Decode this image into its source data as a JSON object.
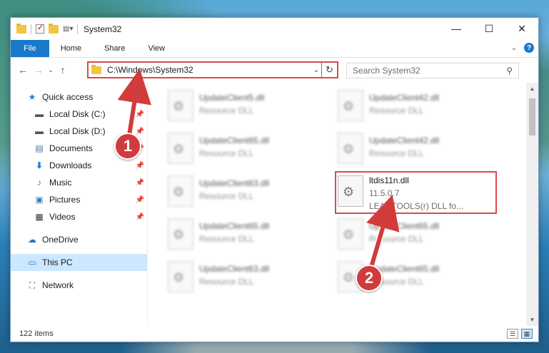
{
  "window": {
    "title": "System32",
    "controls": {
      "minimize": "—",
      "maximize": "☐",
      "close": "✕"
    }
  },
  "ribbon": {
    "tabs": [
      "File",
      "Home",
      "Share",
      "View"
    ],
    "help": "?"
  },
  "address": {
    "path": "C:\\Windows\\System32",
    "search_placeholder": "Search System32"
  },
  "sidebar": {
    "quick_access": "Quick access",
    "items": [
      {
        "label": "Local Disk (C:)",
        "icon": "drive-icon"
      },
      {
        "label": "Local Disk (D:)",
        "icon": "drive-icon"
      },
      {
        "label": "Documents",
        "icon": "documents-icon"
      },
      {
        "label": "Downloads",
        "icon": "downloads-icon"
      },
      {
        "label": "Music",
        "icon": "music-icon"
      },
      {
        "label": "Pictures",
        "icon": "pictures-icon"
      },
      {
        "label": "Videos",
        "icon": "videos-icon"
      }
    ],
    "onedrive": "OneDrive",
    "thispc": "This PC",
    "network": "Network"
  },
  "files": {
    "left": [
      {
        "name": "UpdateClient5.dll",
        "type": "Resource DLL"
      },
      {
        "name": "UpdateClient65.dll",
        "type": "Resource DLL"
      },
      {
        "name": "UpdateClient63.dll",
        "type": "Resource DLL"
      },
      {
        "name": "UpdateClient65.dll",
        "type": "Resource DLL"
      },
      {
        "name": "UpdateClient63.dll",
        "type": "Resource DLL"
      }
    ],
    "right": [
      {
        "name": "UpdateClient42.dll",
        "type": "Resource DLL"
      },
      {
        "name": "UpdateClient42.dll",
        "type": "Resource DLL"
      },
      {
        "name": "UpdateClient65.dll",
        "type": "Resource DLL"
      },
      {
        "name": "UpdateClient65.dll",
        "type": "Resource DLL"
      }
    ],
    "highlighted": {
      "name": "ltdis11n.dll",
      "version": "11.5.0.7",
      "description": "LEADTOOLS(r) DLL fo..."
    }
  },
  "status": {
    "item_count": "122 items"
  },
  "annotations": {
    "step1": "1",
    "step2": "2"
  }
}
